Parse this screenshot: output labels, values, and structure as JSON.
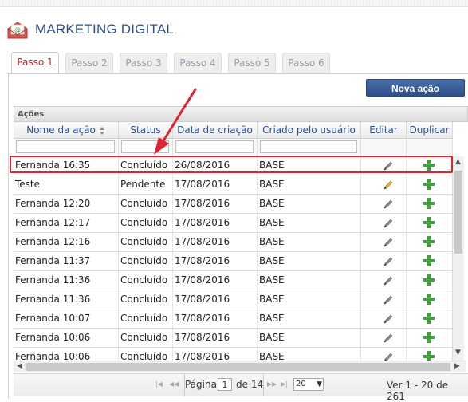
{
  "app": {
    "title": "MARKETING DIGITAL",
    "icon": "envelope-at-icon"
  },
  "tabs": [
    "Passo 1",
    "Passo 2",
    "Passo 3",
    "Passo 4",
    "Passo 5",
    "Passo 6"
  ],
  "active_tab": 0,
  "toolbar": {
    "new_action_label": "Nova ação"
  },
  "grid": {
    "caption": "Ações",
    "columns": [
      "Nome da ação",
      "Status",
      "Data de criação",
      "Criado pelo usuário",
      "Editar",
      "Duplicar"
    ],
    "sort_icon": "sort-arrows-icon",
    "rows": [
      {
        "name": "Fernanda 16:35",
        "status": "Concluído",
        "date": "26/08/2016",
        "user": "BASE",
        "edit_color": "#888888"
      },
      {
        "name": "Teste",
        "status": "Pendente",
        "date": "17/08/2016",
        "user": "BASE",
        "edit_color": "#e8b21a"
      },
      {
        "name": "Fernanda 12:20",
        "status": "Concluído",
        "date": "17/08/2016",
        "user": "BASE",
        "edit_color": "#888888"
      },
      {
        "name": "Fernanda 12:17",
        "status": "Concluído",
        "date": "17/08/2016",
        "user": "BASE",
        "edit_color": "#888888"
      },
      {
        "name": "Fernanda 12:16",
        "status": "Concluído",
        "date": "17/08/2016",
        "user": "BASE",
        "edit_color": "#888888"
      },
      {
        "name": "Fernanda 11:37",
        "status": "Concluído",
        "date": "17/08/2016",
        "user": "BASE",
        "edit_color": "#888888"
      },
      {
        "name": "Fernanda 11:36",
        "status": "Concluído",
        "date": "17/08/2016",
        "user": "BASE",
        "edit_color": "#888888"
      },
      {
        "name": "Fernanda 11:36",
        "status": "Concluído",
        "date": "17/08/2016",
        "user": "BASE",
        "edit_color": "#888888"
      },
      {
        "name": "Fernanda 10:07",
        "status": "Concluído",
        "date": "17/08/2016",
        "user": "BASE",
        "edit_color": "#888888"
      },
      {
        "name": "Fernanda 10:06",
        "status": "Concluído",
        "date": "17/08/2016",
        "user": "BASE",
        "edit_color": "#888888"
      },
      {
        "name": "Fernanda 10:06",
        "status": "Concluído",
        "date": "17/08/2016",
        "user": "BASE",
        "edit_color": "#888888"
      }
    ],
    "edit_icon": "pencil-icon",
    "duplicate_icon": "plus-icon",
    "duplicate_color": "#3aa33a"
  },
  "pager": {
    "page_label": "Página",
    "current_page": "1",
    "of_label": "de 14",
    "page_size": "20",
    "summary": "Ver 1 - 20 de 261"
  },
  "annotation": {
    "color": "#e0232f"
  }
}
